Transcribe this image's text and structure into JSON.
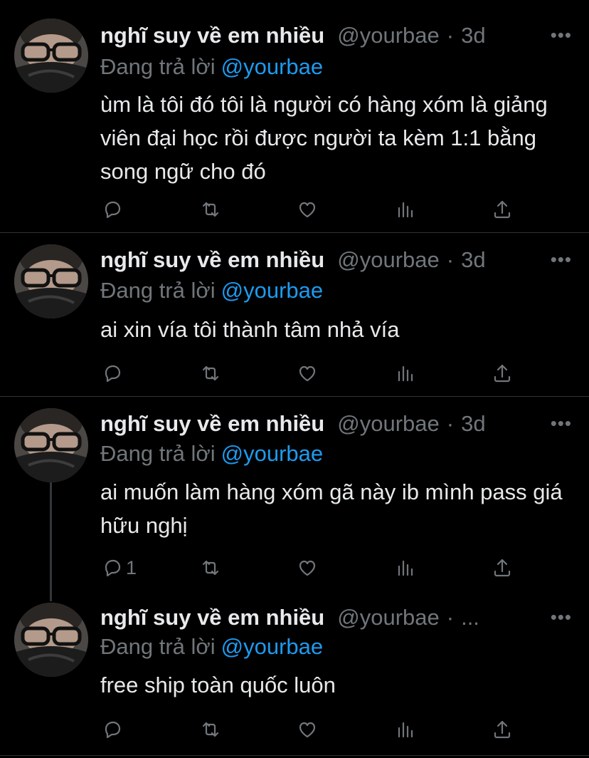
{
  "tweets": [
    {
      "name": "nghĩ suy về em nhiều",
      "handle": "@yourbae",
      "sep": "·",
      "time": "3d",
      "more": "•••",
      "reply_prefix": "Đang trả lời",
      "reply_mention": "@yourbae",
      "text": "ùm là tôi đó tôi là người có hàng xóm là giảng viên đại học rồi được người ta kèm 1:1 bằng song ngữ cho đó",
      "reply_count": ""
    },
    {
      "name": "nghĩ suy về em nhiều",
      "handle": "@yourbae",
      "sep": "·",
      "time": "3d",
      "more": "•••",
      "reply_prefix": "Đang trả lời",
      "reply_mention": "@yourbae",
      "text": "ai xin vía tôi thành tâm nhả vía",
      "reply_count": ""
    },
    {
      "name": "nghĩ suy về em nhiều",
      "handle": "@yourbae",
      "sep": "·",
      "time": "3d",
      "more": "•••",
      "reply_prefix": "Đang trả lời",
      "reply_mention": "@yourbae",
      "text": "ai muốn làm hàng xóm gã này ib mình pass giá hữu nghị",
      "reply_count": "1"
    },
    {
      "name": "nghĩ suy về em nhiều",
      "handle": "@yourbae",
      "sep": "·",
      "time": "...",
      "more": "•••",
      "reply_prefix": "Đang trả lời",
      "reply_mention": "@yourbae",
      "text": "free ship toàn quốc luôn",
      "reply_count": ""
    }
  ],
  "icons": {
    "reply": "reply-icon",
    "retweet": "retweet-icon",
    "like": "like-icon",
    "analytics": "analytics-icon",
    "share": "share-icon",
    "more": "more-icon"
  },
  "colors": {
    "background": "#000000",
    "text": "#e7e9ea",
    "muted": "#71767b",
    "mention": "#1d9bf0",
    "divider": "#2f3336"
  }
}
